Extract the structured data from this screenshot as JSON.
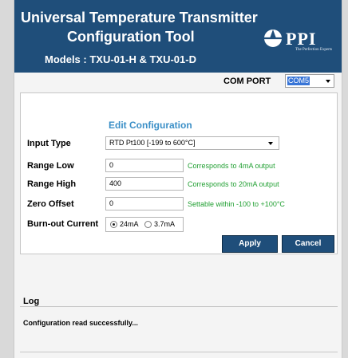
{
  "header": {
    "title_line1": "Universal Temperature Transmitter",
    "title_line2": "Configuration Tool",
    "models": "Models : TXU-01-H & TXU-01-D",
    "logo_text": "PPI",
    "logo_tagline": "The Perfection Experts",
    "bg_color": "#1f4e7a"
  },
  "com_port": {
    "label": "COM PORT",
    "selected": "COM5"
  },
  "config": {
    "title": "Edit Configuration",
    "input_type": {
      "label": "Input Type",
      "value": "RTD Pt100 [-199 to 600°C]"
    },
    "range_low": {
      "label": "Range Low",
      "value": "0",
      "hint": "Corresponds to 4mA output"
    },
    "range_high": {
      "label": "Range High",
      "value": "400",
      "hint": "Corresponds to 20mA output"
    },
    "zero_offset": {
      "label": "Zero Offset",
      "value": "0",
      "hint": "Settable within -100 to +100°C"
    },
    "burnout": {
      "label": "Burn-out Current",
      "options": [
        {
          "label": "24mA",
          "checked": true
        },
        {
          "label": "3.7mA",
          "checked": false
        }
      ]
    },
    "apply_label": "Apply",
    "cancel_label": "Cancel",
    "hint_color": "#22a033",
    "title_color": "#3b8fc7"
  },
  "log": {
    "title": "Log",
    "message": "Configuration read successfully..."
  }
}
